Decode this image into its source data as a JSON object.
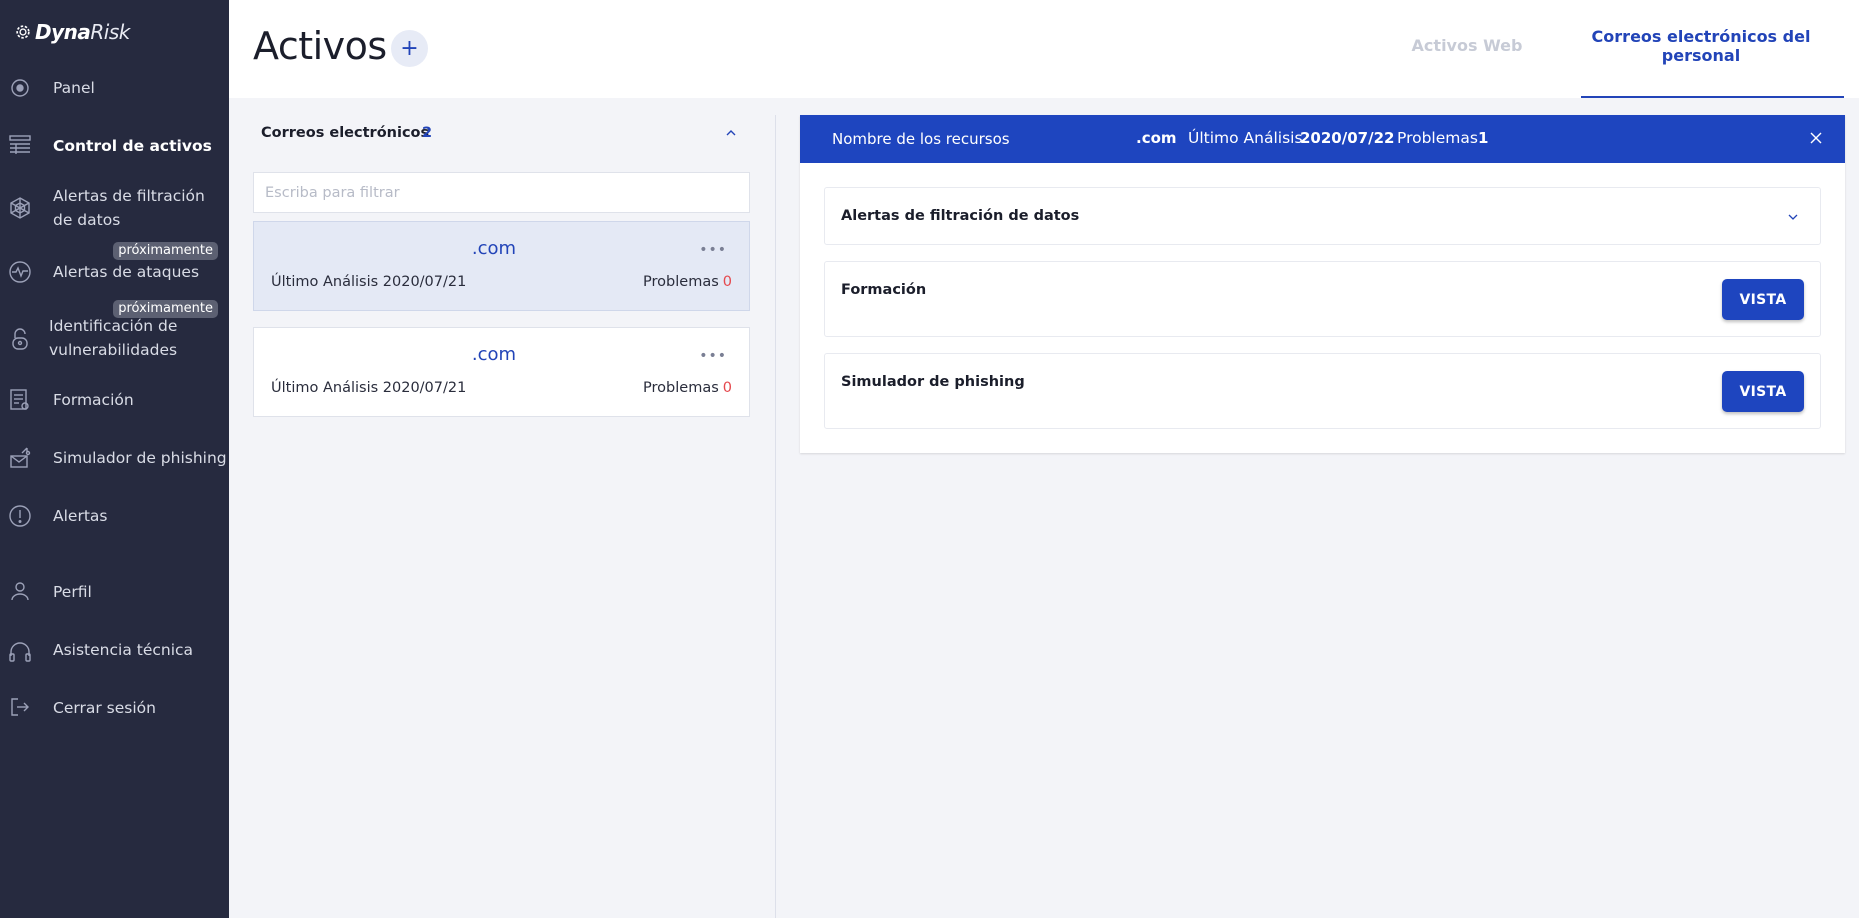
{
  "app": {
    "logo_main": "Dyna",
    "logo_sub": "Risk"
  },
  "sidebar": {
    "items": [
      {
        "label": "Panel",
        "icon": "panel-icon"
      },
      {
        "label": "Control de activos",
        "icon": "assets-icon",
        "active": true
      },
      {
        "label": "Alertas de filtración de datos",
        "icon": "web-icon"
      },
      {
        "label": "Alertas de ataques",
        "icon": "pulse-icon",
        "badge": "próximamente"
      },
      {
        "label": "Identificación de vulnerabilidades",
        "icon": "lock-icon",
        "badge": "próximamente"
      },
      {
        "label": "Formación",
        "icon": "training-icon"
      },
      {
        "label": "Simulador de phishing",
        "icon": "phishing-icon"
      },
      {
        "label": "Alertas",
        "icon": "alert-icon"
      },
      {
        "label": "Perfil",
        "icon": "user-icon"
      },
      {
        "label": "Asistencia técnica",
        "icon": "headset-icon"
      },
      {
        "label": "Cerrar sesión",
        "icon": "logout-icon"
      }
    ]
  },
  "header": {
    "title": "Activos",
    "add_label": "+",
    "tabs": [
      {
        "label": "Activos Web",
        "active": false
      },
      {
        "label": "Correos electrónicos del personal",
        "active": true
      }
    ]
  },
  "list": {
    "heading": "Correos electrónicos",
    "count": "2",
    "filter_placeholder": "Escriba para filtrar",
    "cards": [
      {
        "domain": ".com",
        "analysis_label": "Último Análisis",
        "date": "2020/07/21",
        "problems_label": "Problemas",
        "problems": "0",
        "selected": true
      },
      {
        "domain": ".com",
        "analysis_label": "Último Análisis",
        "date": "2020/07/21",
        "problems_label": "Problemas",
        "problems": "0",
        "selected": false
      }
    ]
  },
  "detail": {
    "name_label": "Nombre de los recursos",
    "domain": ".com",
    "analysis_label": "Último Análisis",
    "date": "2020/07/22",
    "problems_label": "Problemas",
    "problems": "1",
    "rows": [
      {
        "title": "Alertas de filtración de datos"
      },
      {
        "title": "Formación",
        "button": "VISTA"
      },
      {
        "title": "Simulador de phishing",
        "button": "VISTA"
      }
    ]
  },
  "colors": {
    "sidebar_bg": "#262a3f",
    "accent": "#1e45bf",
    "problems_count": "#e5484d"
  }
}
